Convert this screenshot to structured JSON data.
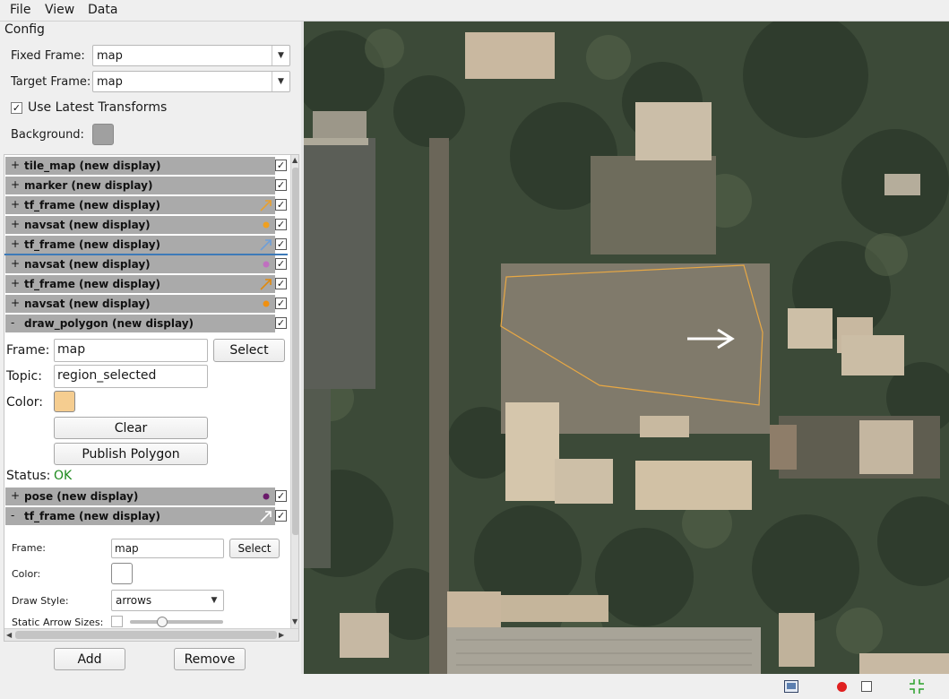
{
  "menu": [
    "File",
    "View",
    "Data"
  ],
  "config": {
    "title": "Config",
    "fixed_frame_label": "Fixed Frame:",
    "fixed_frame_value": "map",
    "target_frame_label": "Target Frame:",
    "target_frame_value": "map",
    "use_latest_label": "Use Latest Transforms",
    "use_latest_checked": true,
    "background_label": "Background:",
    "background_color": "#a0a0a0"
  },
  "displays": [
    {
      "expander": "+",
      "label": "tile_map (new display)",
      "icon": "none",
      "checked": true
    },
    {
      "expander": "+",
      "label": "marker (new display)",
      "icon": "none",
      "checked": true
    },
    {
      "expander": "+",
      "label": "tf_frame (new display)",
      "icon": "arrow-icon",
      "icon_color": "#e8a030",
      "checked": true
    },
    {
      "expander": "+",
      "label": "navsat (new display)",
      "icon": "dot-icon",
      "icon_color": "#f0a020",
      "checked": true
    },
    {
      "expander": "+",
      "label": "tf_frame (new display)",
      "icon": "arrow-icon",
      "icon_color": "#6f9fd8",
      "checked": true
    },
    {
      "expander": "+",
      "label": "navsat (new display)",
      "icon": "dot-icon",
      "icon_color": "#c070c0",
      "checked": true
    },
    {
      "expander": "+",
      "label": "tf_frame (new display)",
      "icon": "arrow-icon",
      "icon_color": "#e08a10",
      "checked": true
    },
    {
      "expander": "+",
      "label": "navsat (new display)",
      "icon": "dot-icon",
      "icon_color": "#f09010",
      "checked": true
    },
    {
      "expander": "-",
      "label": "draw_polygon (new display)",
      "icon": "none",
      "checked": true
    }
  ],
  "draw_polygon": {
    "frame_label": "Frame:",
    "frame_value": "map",
    "select_label": "Select",
    "topic_label": "Topic:",
    "topic_value": "region_selected",
    "color_label": "Color:",
    "color_value": "#f5cd90",
    "clear_label": "Clear",
    "publish_label": "Publish Polygon",
    "status_label": "Status:",
    "status_value": "OK",
    "status_color": "#1e8a1e"
  },
  "displays_after": [
    {
      "expander": "+",
      "label": "pose (new display)",
      "icon": "dot-icon",
      "icon_color": "#6a1a6a",
      "checked": true
    },
    {
      "expander": "-",
      "label": "tf_frame (new display)",
      "icon": "arrow-icon",
      "icon_color": "#ffffff",
      "checked": true
    }
  ],
  "tf_frame": {
    "frame_label": "Frame:",
    "frame_value": "map",
    "select_label": "Select",
    "color_label": "Color:",
    "color_value": "#ffffff",
    "draw_style_label": "Draw Style:",
    "draw_style_value": "arrows",
    "static_arrow_label": "Static Arrow Sizes:",
    "static_arrow_checked": false,
    "arrow_size_fraction": 0.34
  },
  "buttons": {
    "add": "Add",
    "remove": "Remove"
  },
  "status_icons": [
    "image-icon",
    "record-icon",
    "stop-icon",
    "fit-icon"
  ]
}
